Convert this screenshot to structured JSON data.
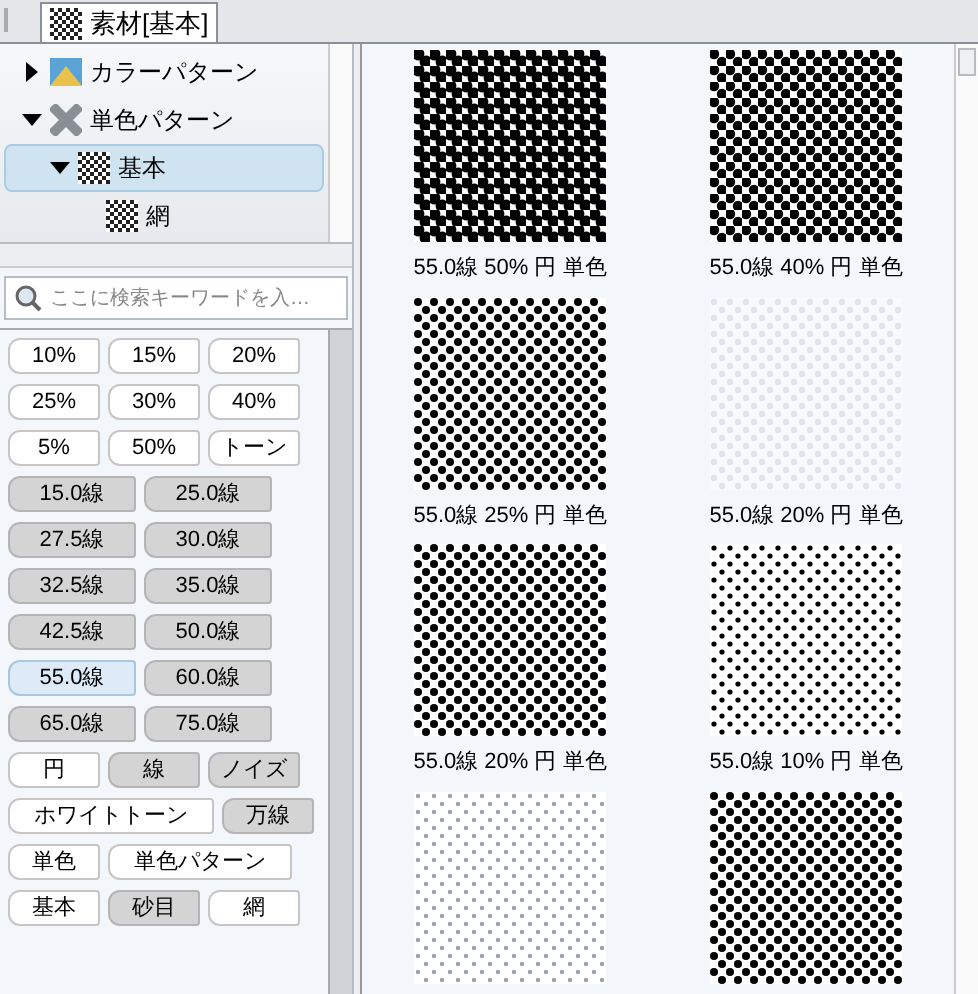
{
  "tab": {
    "title": "素材[基本]",
    "selected": true
  },
  "tree": [
    {
      "label": "カラーパターン",
      "expanded": false,
      "selected": false,
      "kind": "color"
    },
    {
      "label": "単色パターン",
      "expanded": true,
      "selected": false,
      "kind": "mono",
      "children": [
        {
          "label": "基本",
          "expanded": true,
          "selected": true,
          "kind": "tone",
          "children": [
            {
              "label": "網",
              "selected": false,
              "kind": "tone"
            }
          ]
        }
      ]
    }
  ],
  "search": {
    "placeholder": "ここに検索キーワードを入…"
  },
  "tags": [
    {
      "label": "10%",
      "kind": "plain",
      "selected": false
    },
    {
      "label": "15%",
      "kind": "plain",
      "selected": false
    },
    {
      "label": "20%",
      "kind": "plain",
      "selected": false
    },
    {
      "label": "25%",
      "kind": "plain",
      "selected": false
    },
    {
      "label": "30%",
      "kind": "plain",
      "selected": false
    },
    {
      "label": "40%",
      "kind": "plain",
      "selected": false
    },
    {
      "label": "5%",
      "kind": "plain",
      "selected": false
    },
    {
      "label": "50%",
      "kind": "plain",
      "selected": false
    },
    {
      "label": "トーン",
      "kind": "plain",
      "selected": false
    },
    {
      "label": "15.0線",
      "kind": "shaded",
      "selected": false
    },
    {
      "label": "25.0線",
      "kind": "shaded",
      "selected": false
    },
    {
      "label": "27.5線",
      "kind": "shaded",
      "selected": false
    },
    {
      "label": "30.0線",
      "kind": "shaded",
      "selected": false
    },
    {
      "label": "32.5線",
      "kind": "shaded",
      "selected": false
    },
    {
      "label": "35.0線",
      "kind": "shaded",
      "selected": false
    },
    {
      "label": "42.5線",
      "kind": "shaded",
      "selected": false
    },
    {
      "label": "50.0線",
      "kind": "shaded",
      "selected": false
    },
    {
      "label": "55.0線",
      "kind": "shaded",
      "selected": true
    },
    {
      "label": "60.0線",
      "kind": "shaded",
      "selected": false
    },
    {
      "label": "65.0線",
      "kind": "shaded",
      "selected": false
    },
    {
      "label": "75.0線",
      "kind": "shaded",
      "selected": false
    },
    {
      "label": "円",
      "kind": "plain",
      "selected": false
    },
    {
      "label": "線",
      "kind": "shaded",
      "selected": false
    },
    {
      "label": "ノイズ",
      "kind": "shaded",
      "selected": false
    },
    {
      "label": "ホワイトトーン",
      "kind": "plain",
      "selected": false
    },
    {
      "label": "万線",
      "kind": "shaded",
      "selected": false
    },
    {
      "label": "単色",
      "kind": "plain",
      "selected": false
    },
    {
      "label": "単色パターン",
      "kind": "plain",
      "selected": false
    },
    {
      "label": "基本",
      "kind": "plain",
      "selected": false
    },
    {
      "label": "砂目",
      "kind": "shaded",
      "selected": false
    },
    {
      "label": "網",
      "kind": "plain",
      "selected": false
    }
  ],
  "materials": [
    {
      "caption": "55.0線 50% 円 単色",
      "kind": "heavy"
    },
    {
      "caption": "55.0線 40% 円 単色",
      "kind": "dark"
    },
    {
      "caption": "55.0線 25% 円 単色",
      "kind": "medium"
    },
    {
      "caption": "55.0線 20% 円 単色",
      "kind": "ghost"
    },
    {
      "caption": "55.0線 20% 円 単色",
      "kind": "medium"
    },
    {
      "caption": "55.0線 10% 円 単色",
      "kind": "light"
    },
    {
      "kind": "faint"
    },
    {
      "kind": "medium"
    }
  ]
}
